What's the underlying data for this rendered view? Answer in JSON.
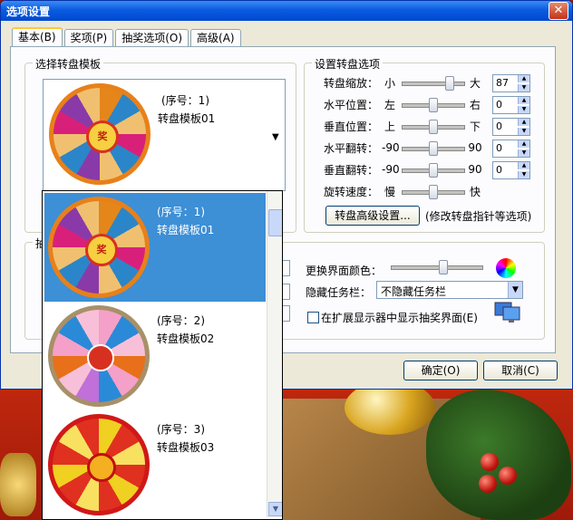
{
  "window": {
    "title": "选项设置",
    "close_glyph": "✕"
  },
  "tabs": [
    {
      "label": "基本(B)",
      "active": true
    },
    {
      "label": "奖项(P)",
      "active": false
    },
    {
      "label": "抽奖选项(O)",
      "active": false
    },
    {
      "label": "高级(A)",
      "active": false
    }
  ],
  "template_group": {
    "legend": "选择转盘模板",
    "selected": {
      "number": "(序号：1)",
      "name": "转盘模板01"
    }
  },
  "dropdown": {
    "items": [
      {
        "number": "(序号：1)",
        "name": "转盘模板01",
        "selected": true
      },
      {
        "number": "(序号：2)",
        "name": "转盘模板02",
        "selected": false
      },
      {
        "number": "(序号：3)",
        "name": "转盘模板03",
        "selected": false
      }
    ]
  },
  "hidden_group_legend_fragment": "抽",
  "wheel_settings": {
    "legend": "设置转盘选项",
    "rows": [
      {
        "label": "转盘缩放：",
        "min": "小",
        "max": "大",
        "value": "87",
        "level": 0.8
      },
      {
        "label": "水平位置：",
        "min": "左",
        "max": "右",
        "value": "0",
        "level": 0.5
      },
      {
        "label": "垂直位置：",
        "min": "上",
        "max": "下",
        "value": "0",
        "level": 0.5
      },
      {
        "label": "水平翻转：",
        "min": "-90",
        "max": "90",
        "value": "0",
        "level": 0.5
      },
      {
        "label": "垂直翻转：",
        "min": "-90",
        "max": "90",
        "value": "0",
        "level": 0.5
      },
      {
        "label": "旋转速度：",
        "min": "慢",
        "max": "快",
        "level": 0.5
      }
    ],
    "advanced_button": "转盘高级设置...",
    "advanced_note": "(修改转盘指针等选项)"
  },
  "other": {
    "ui_color_label": "更换界面颜色：",
    "ui_color_level": 0.58,
    "taskbar_label": "隐藏任务栏：",
    "taskbar_value": "不隐藏任务栏",
    "ext_display_label": "在扩展显示器中显示抽奖界面(E)",
    "ext_display_checked": false
  },
  "buttons": {
    "ok": "确定(O)",
    "cancel": "取消(C)"
  },
  "wheel_center_label": "奖",
  "colors": {
    "title_blue": "#0a5ce0",
    "selection_blue": "#3d8fd6",
    "window_bg": "#ece9d8"
  },
  "icons": [
    "close-icon",
    "dropdown-arrow-icon",
    "scroll-up-icon",
    "scroll-down-icon",
    "color-wheel-icon",
    "monitor-icon"
  ]
}
